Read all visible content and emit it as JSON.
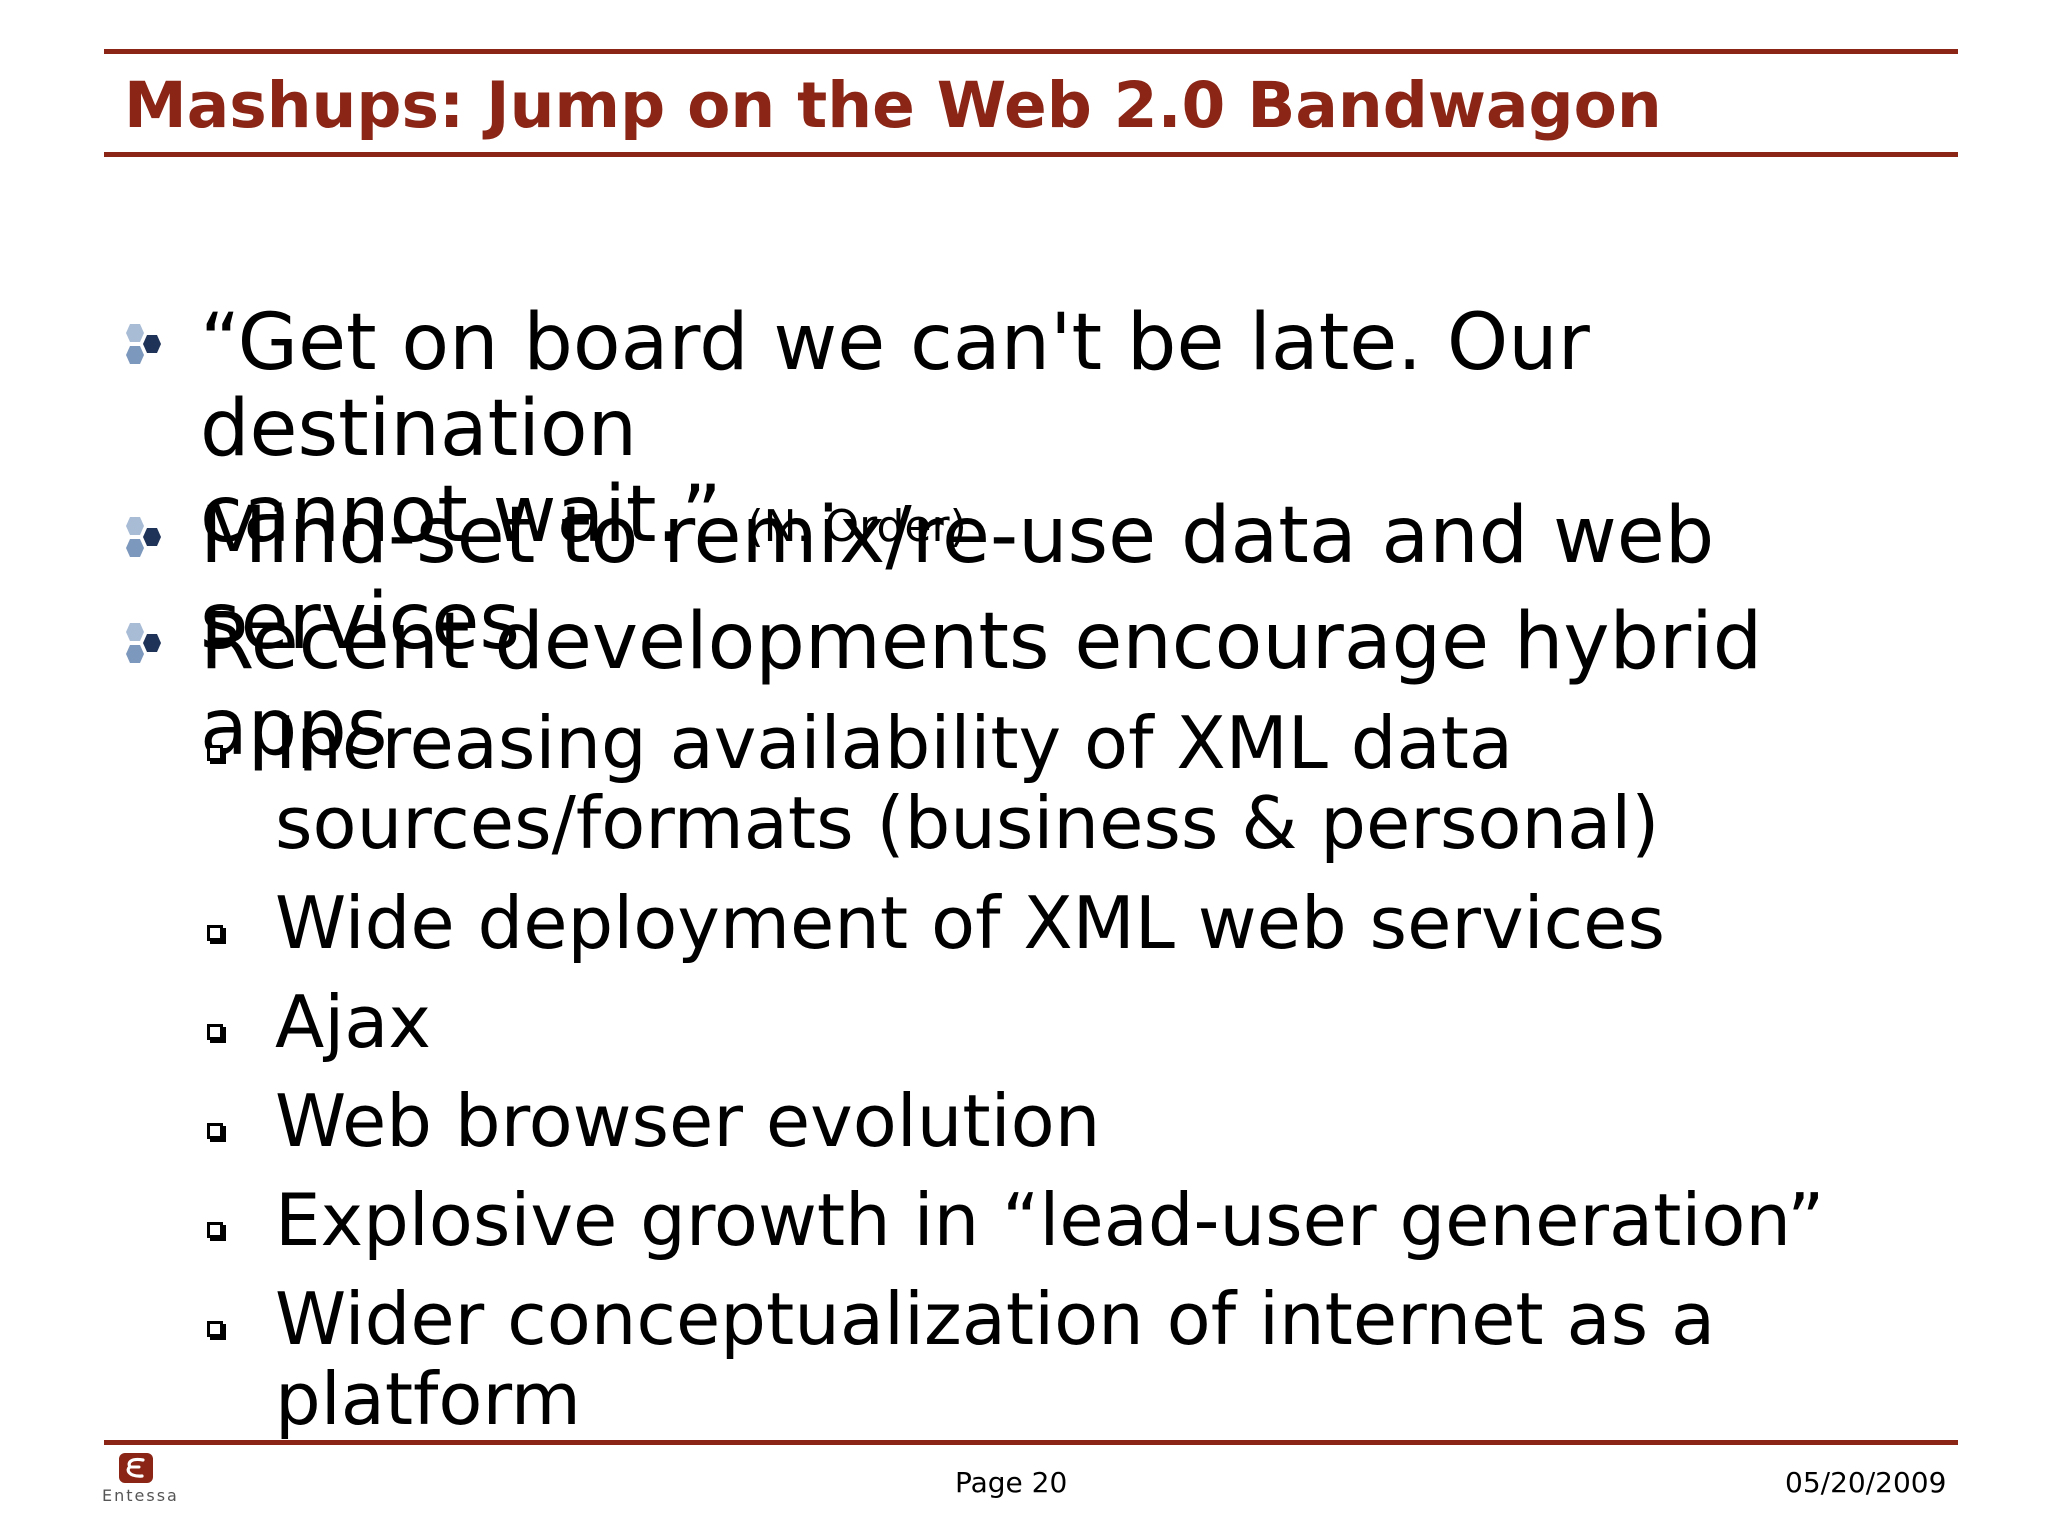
{
  "slide": {
    "title": "Mashups: Jump on the Web 2.0 Bandwagon",
    "accent_color": "#8b2515"
  },
  "bullets": [
    {
      "line1": "“Get on board we can't be late. Our destination",
      "line2": "cannot wait.”",
      "citation": "(N. Order)"
    },
    {
      "text": "Mind-set to remix/re-use data and web services"
    },
    {
      "text": "Recent developments encourage hybrid apps"
    }
  ],
  "sub_bullets": [
    {
      "line1": "Increasing availability of XML data",
      "line2": "sources/formats (business & personal)"
    },
    {
      "text": "Wide deployment of XML web services"
    },
    {
      "text": "Ajax"
    },
    {
      "text": "Web browser evolution"
    },
    {
      "text": "Explosive growth in “lead-user generation”"
    },
    {
      "text": "Wider conceptualization of internet as a platform"
    }
  ],
  "footer": {
    "logo_text": "Entessa",
    "page": "Page 20",
    "date": "05/20/2009"
  }
}
